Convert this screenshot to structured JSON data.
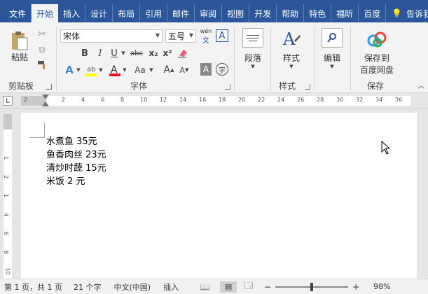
{
  "tabs": [
    "文件",
    "开始",
    "插入",
    "设计",
    "布局",
    "引用",
    "邮件",
    "审阅",
    "视图",
    "开发",
    "帮助",
    "特色",
    "福昕",
    "百度"
  ],
  "active_tab": "开始",
  "tell_me": "告诉我",
  "ribbon": {
    "clipboard": {
      "paste": "粘贴",
      "label": "剪贴板"
    },
    "font": {
      "name": "宋体",
      "size": "五号",
      "phonetic": "wén",
      "label": "字体",
      "buttons": {
        "bold": "B",
        "italic": "I",
        "underline": "U",
        "strike": "abc",
        "sub": "x₂",
        "sup": "x²",
        "grow": "A",
        "shrink": "Aa"
      }
    },
    "paragraph": {
      "label": "段落"
    },
    "styles": {
      "button": "样式",
      "label": "样式"
    },
    "editing": {
      "button": "编辑"
    },
    "save": {
      "button_line1": "保存到",
      "button_line2": "百度网盘",
      "label": "保存"
    }
  },
  "ruler_numbers": [
    "2",
    "2",
    "4",
    "6",
    "8",
    "10",
    "12",
    "14",
    "16",
    "18",
    "20",
    "22",
    "24",
    "26",
    "28",
    "30",
    "32",
    "34",
    "36"
  ],
  "vruler_numbers": [
    "1",
    "2",
    "1",
    "4",
    "6",
    "8",
    "10"
  ],
  "document": {
    "lines": [
      "水煮鱼 35元",
      "鱼香肉丝 23元",
      "清炒时蔬 15元",
      "米饭 2 元"
    ]
  },
  "status": {
    "page": "第 1 页，共 1 页",
    "words": "21 个字",
    "lang": "中文(中国)",
    "mode": "插入",
    "zoom": "98%"
  },
  "colors": {
    "brand": "#2b579a",
    "ribbon_bg": "#f3f3f3",
    "highlight": "#ffff00",
    "font_color": "#e81123"
  }
}
